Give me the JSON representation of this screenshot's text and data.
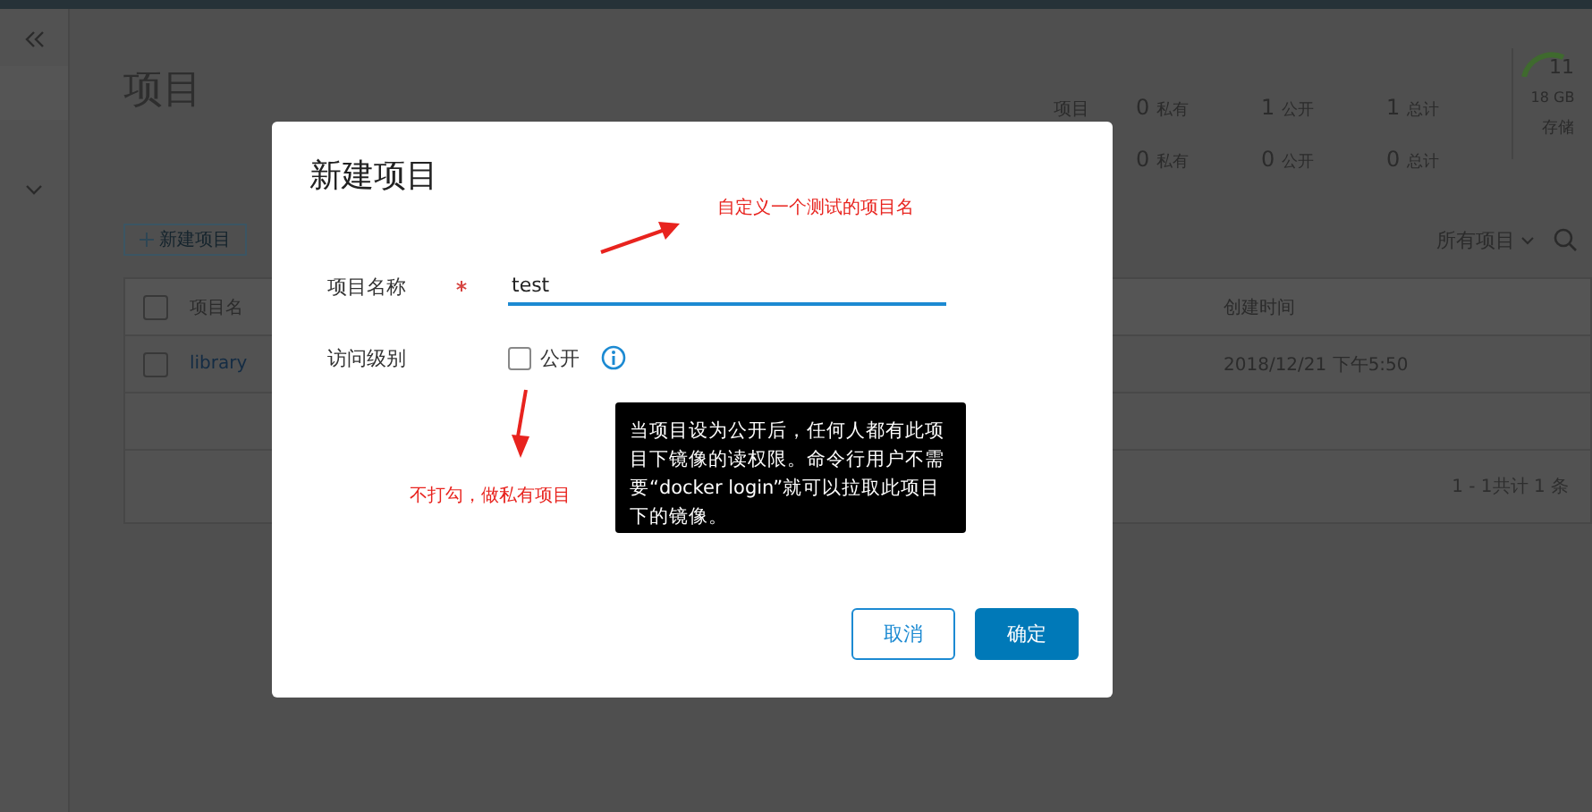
{
  "page": {
    "title": "项目",
    "stats": [
      {
        "label": "项目",
        "cells": [
          {
            "count": "0",
            "label": "私有"
          },
          {
            "count": "1",
            "label": "公开"
          },
          {
            "count": "1",
            "label": "总计"
          }
        ]
      },
      {
        "cells": [
          {
            "count": "0",
            "label": "私有"
          },
          {
            "count": "0",
            "label": "公开"
          },
          {
            "count": "0",
            "label": "总计"
          }
        ]
      }
    ],
    "storage": {
      "value": "11",
      "amount": "18 GB",
      "label": "存储"
    },
    "new_button": "新建项目",
    "filter": "所有项目",
    "table": {
      "header_checked": false,
      "columns": [
        {
          "label": "项目名"
        },
        {
          "label": "创建时间"
        }
      ],
      "rows": [
        {
          "checked": false,
          "cells": [
            "library",
            "2018/12/21 下午5:50"
          ]
        }
      ],
      "footer": "1 - 1共计 1 条"
    }
  },
  "dialog": {
    "title": "新建项目",
    "fields": [
      {
        "kind": "text",
        "label": "项目名称",
        "required": true,
        "value": "test"
      },
      {
        "kind": "checkbox",
        "label": "访问级别",
        "option": "公开",
        "checked": false
      }
    ],
    "tooltip": "当项目设为公开后，任何人都有此项目下镜像的读权限。命令行用户不需要“docker login”就可以拉取此项目下的镜像。",
    "buttons": [
      {
        "label": "取消",
        "kind": "secondary"
      },
      {
        "label": "确定",
        "kind": "primary"
      }
    ]
  },
  "annotations": [
    {
      "text": "自定义一个测试的项目名",
      "kind": "right"
    },
    {
      "text": "不打勾，做私有项目",
      "kind": "below"
    }
  ]
}
